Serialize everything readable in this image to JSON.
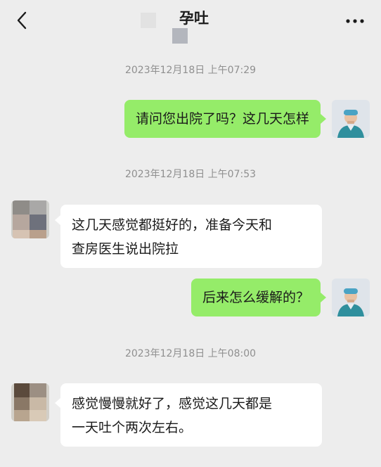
{
  "header": {
    "title": "孕吐",
    "back_icon": "chevron-left-icon",
    "more_icon": "more-dots-icon"
  },
  "messages": [
    {
      "time": "2023年12月18日 上午07:29",
      "side": "right",
      "text": "请问您出院了吗？这几天怎样"
    },
    {
      "time": "2023年12月18日 上午07:53",
      "side": "left",
      "lines": [
        "这几天感觉都挺好的，准备今天和",
        "查房医生说出院拉"
      ]
    },
    {
      "side": "right",
      "text": "后来怎么缓解的？"
    },
    {
      "time": "2023年12月18日 上午08:00",
      "side": "left",
      "lines": [
        "感觉慢慢就好了，感觉这几天都是",
        "一天吐个两次左右。"
      ]
    }
  ],
  "colors": {
    "background": "#ededed",
    "my_bubble": "#95ec69",
    "other_bubble": "#ffffff",
    "timestamp": "#8f8f8f"
  }
}
